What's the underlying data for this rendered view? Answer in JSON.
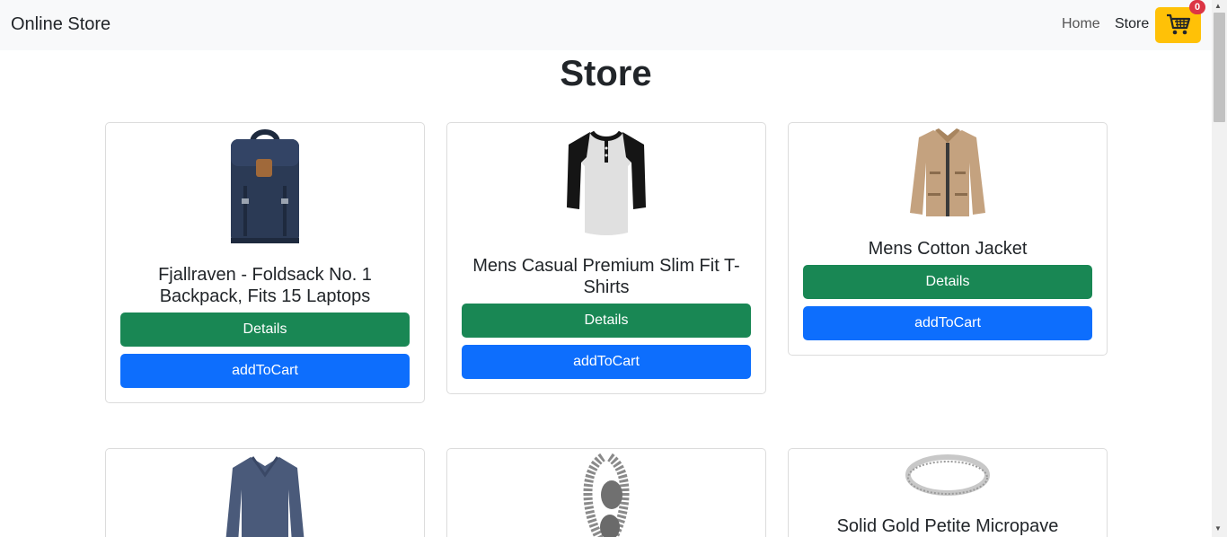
{
  "navbar": {
    "brand": "Online Store",
    "links": [
      "Home",
      "Store"
    ],
    "cart_count": "0"
  },
  "page": {
    "title": "Store"
  },
  "products": [
    {
      "title": "Fjallraven - Foldsack No. 1 Backpack, Fits 15 Laptops",
      "details_label": "Details",
      "cart_label": "addToCart",
      "image": "backpack"
    },
    {
      "title": "Mens Casual Premium Slim Fit T-Shirts",
      "details_label": "Details",
      "cart_label": "addToCart",
      "image": "t-shirt"
    },
    {
      "title": "Mens Cotton Jacket",
      "details_label": "Details",
      "cart_label": "addToCart",
      "image": "jacket"
    },
    {
      "title": "",
      "image": "long-sleeve-shirt"
    },
    {
      "title": "",
      "image": "bracelet"
    },
    {
      "title": "Solid Gold Petite Micropave",
      "image": "ring"
    }
  ],
  "colors": {
    "green": "#198754",
    "blue": "#0d6efd",
    "cart": "#ffc107",
    "badge": "#dc3545"
  }
}
